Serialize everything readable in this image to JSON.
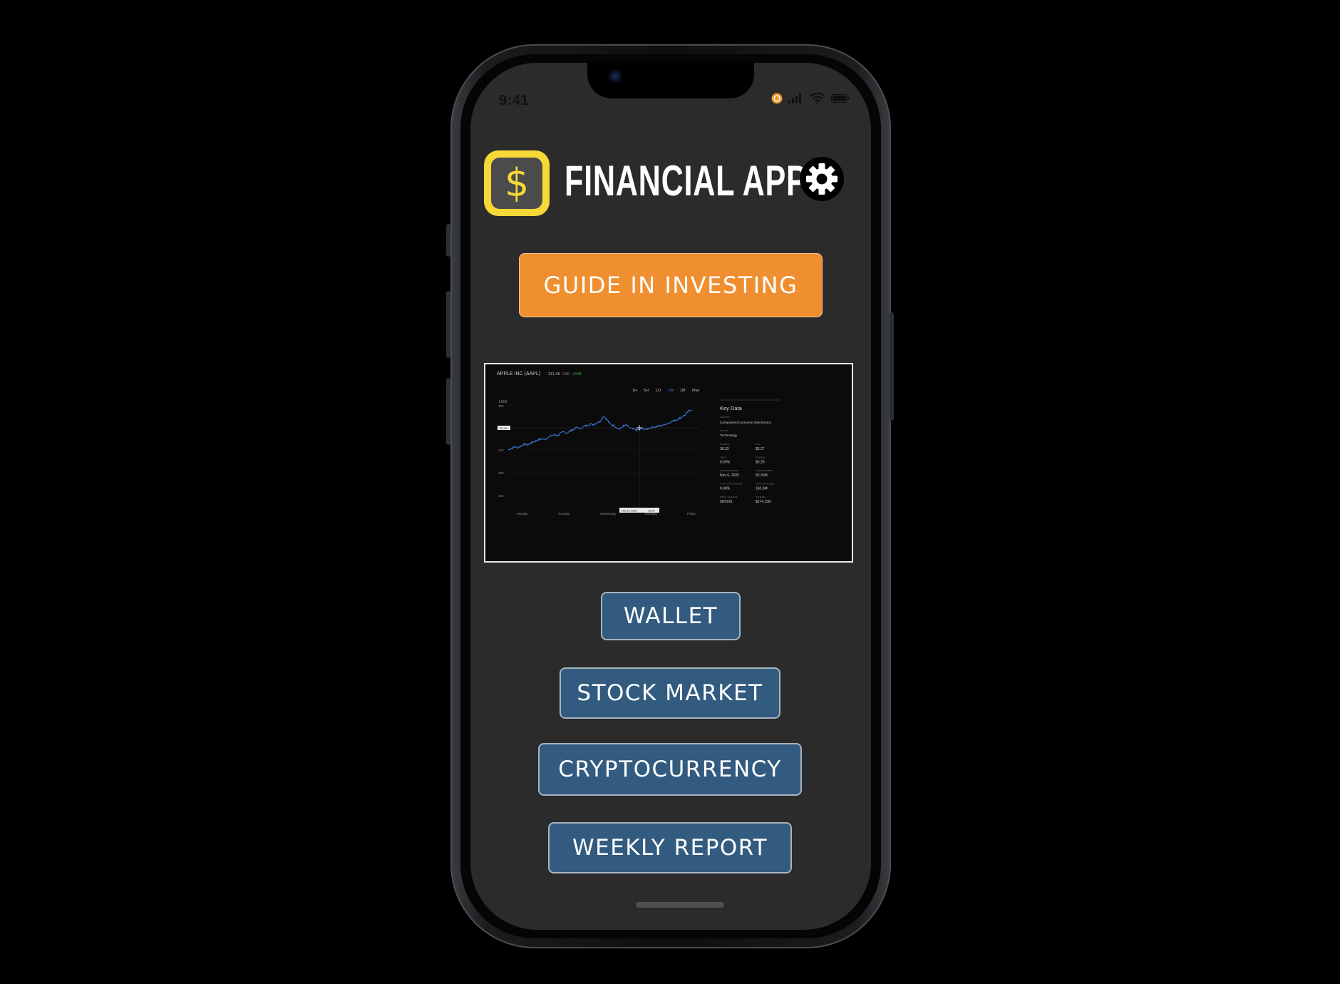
{
  "status_bar": {
    "time": "9:41"
  },
  "app": {
    "title": "FINANCIAL APP",
    "logo_symbol": "$",
    "settings_icon": "gear-icon",
    "accent": "#f6d937"
  },
  "buttons": {
    "guide": "GUIDE IN INVESTING",
    "wallet": "WALLET",
    "stock_market": "STOCK MARKET",
    "cryptocurrency": "CRYPTOCURRENCY",
    "weekly_report": "WEEKLY REPORT"
  },
  "colors": {
    "guide_button": "#ef8f2f",
    "nav_button": "#325b7f",
    "screen_bg": "#2b2b2b",
    "line": "#3f7fe6"
  },
  "chart": {
    "ticker": "APPLE INC (AAPL)",
    "price": "311.48",
    "currency": "USD",
    "change": "+0.05",
    "range_options": [
      "1H",
      "5H",
      "1D",
      "1W",
      "1M",
      "Max"
    ],
    "selected_range": "1W",
    "hover_value": "321.50",
    "hover_date": "Oct 14, 2020",
    "hover_time": "10:00",
    "key_data": {
      "title": "Key Data",
      "industry_label": "INDUSTRY",
      "industry": "Computers/Consumer Electronics",
      "sector_label": "SECTOR",
      "sector": "Technology",
      "fields": [
        {
          "label": "P/E RATIO",
          "value": "36.33"
        },
        {
          "label": "EPS",
          "value": "$3.27"
        },
        {
          "label": "YIELD",
          "value": "0.69%"
        },
        {
          "label": "DIVIDEND",
          "value": "$0.26"
        },
        {
          "label": "EX-DIVIDEND DATE",
          "value": "Nov 6, 2020"
        },
        {
          "label": "SHORT INTEREST",
          "value": "83.25M"
        },
        {
          "label": "% OF FLOAT SHORTED",
          "value": "0.48%"
        },
        {
          "label": "AVERAGE VOLUME",
          "value": "160.9M"
        },
        {
          "label": "FISCAL YEAR END",
          "value": "09/2021"
        },
        {
          "label": "REVENUE",
          "value": "$274.15B"
        }
      ]
    }
  },
  "chart_data": {
    "type": "line",
    "title": "APPLE INC (AAPL)",
    "ylabel": "USD",
    "ylim": [
      215,
      365
    ],
    "y_ticks": [
      360,
      330,
      340,
      330,
      320
    ],
    "x_ticks": [
      "Monday",
      "Tuesday",
      "Wednesday",
      "Thursday",
      "Friday"
    ],
    "series": [
      {
        "values": [
          300,
          302,
          304,
          303,
          306,
          308,
          307,
          310,
          312,
          314,
          316,
          315,
          318,
          320,
          322,
          321,
          324,
          326,
          325,
          328,
          330,
          333,
          331,
          334,
          336,
          338,
          337,
          340,
          342,
          350,
          345,
          338,
          336,
          333,
          330,
          335,
          336,
          332,
          330,
          329,
          330,
          331,
          330,
          332,
          333,
          334,
          335,
          336,
          338,
          340,
          342,
          344,
          346,
          349,
          352,
          357,
          360
        ]
      }
    ]
  }
}
